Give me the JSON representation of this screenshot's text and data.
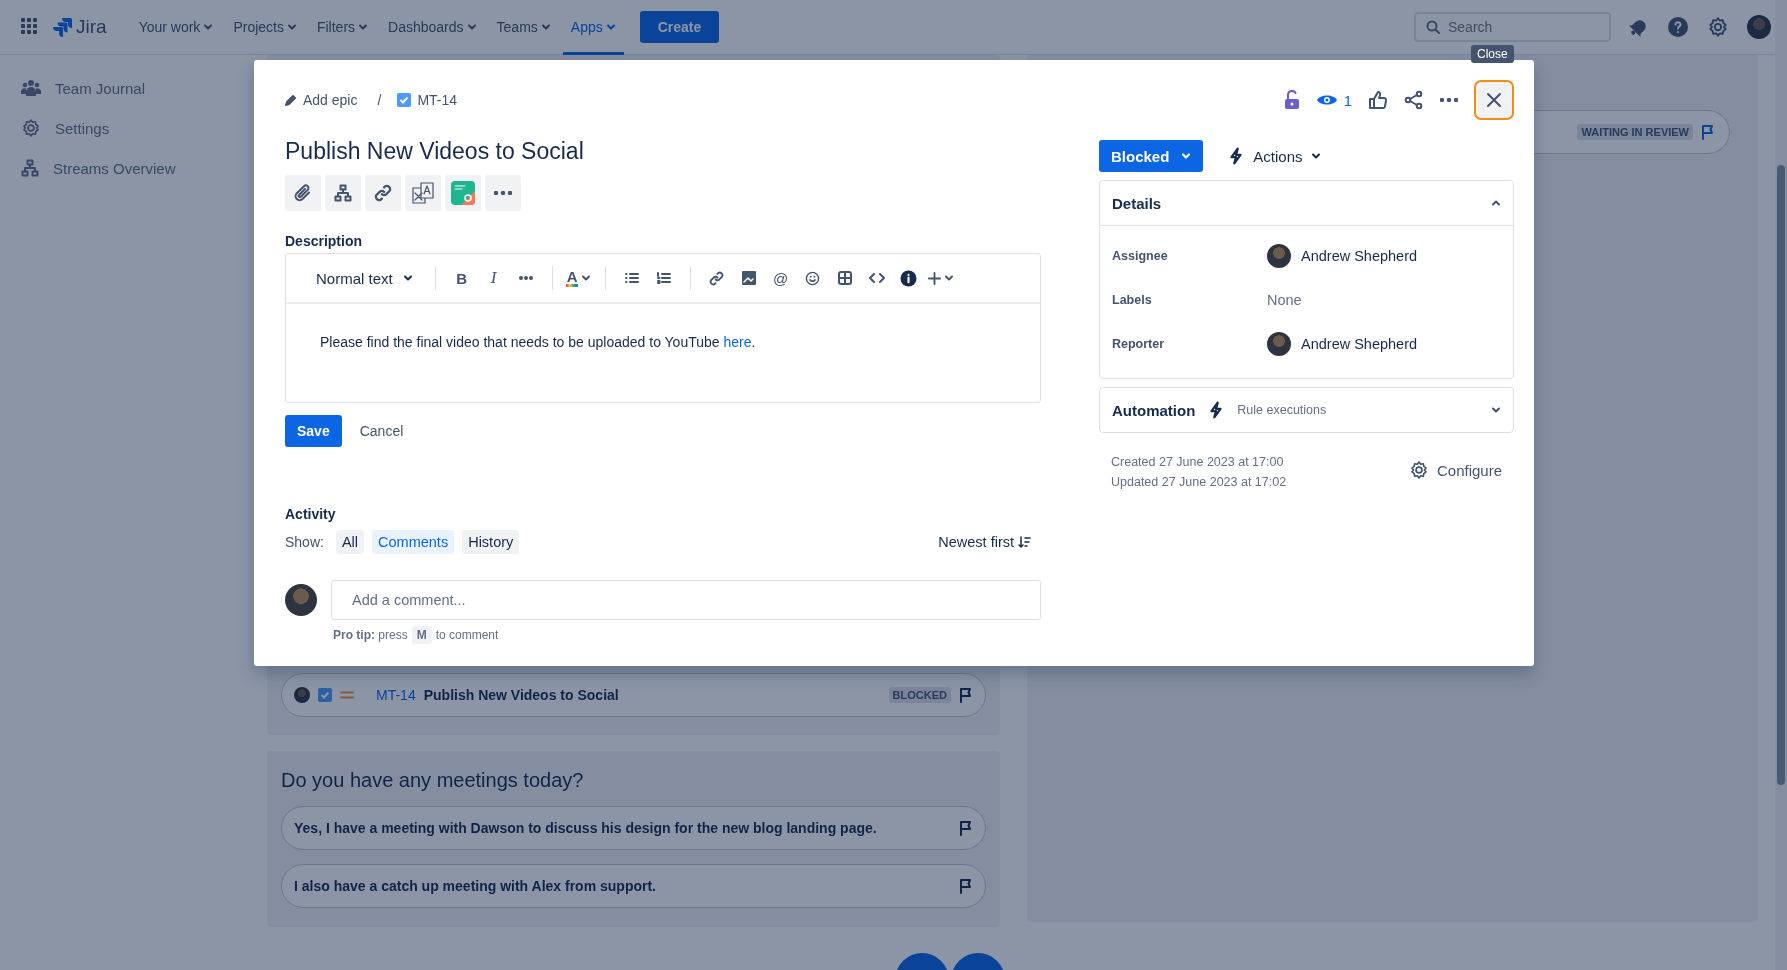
{
  "nav": {
    "logo": "Jira",
    "items": [
      {
        "label": "Your work",
        "selected": false
      },
      {
        "label": "Projects",
        "selected": false
      },
      {
        "label": "Filters",
        "selected": false
      },
      {
        "label": "Dashboards",
        "selected": false
      },
      {
        "label": "Teams",
        "selected": false
      },
      {
        "label": "Apps",
        "selected": true
      }
    ],
    "create": "Create",
    "search": {
      "placeholder": "Search"
    }
  },
  "sidebar": {
    "items": [
      {
        "label": "Team Journal",
        "kind": "team"
      },
      {
        "label": "Settings",
        "kind": "settings"
      },
      {
        "label": "Streams Overview",
        "kind": "hierarchy"
      }
    ]
  },
  "board": {
    "issue": {
      "key": "MT-14",
      "title": "Publish New Videos to Social",
      "status": "BLOCKED"
    },
    "meetings": {
      "question": "Do you have any meetings today?",
      "answers": [
        "Yes, I have a meeting with Dawson to discuss his design for the new blog landing page.",
        "I also have a catch up meeting with Alex from support."
      ]
    },
    "review": {
      "status": "WAITING IN REVIEW"
    }
  },
  "modal": {
    "breadcrumb": {
      "epic": "Add epic",
      "separator": "/",
      "key": "MT-14"
    },
    "watchers": "1",
    "close": {
      "tooltip": "Close",
      "focused": true
    },
    "title": "Publish New Videos to Social",
    "quick_actions": [
      {
        "kind": "attach"
      },
      {
        "kind": "child"
      },
      {
        "kind": "link"
      },
      {
        "kind": "translate"
      },
      {
        "kind": "app"
      },
      {
        "kind": "more"
      }
    ],
    "description": {
      "label": "Description",
      "toolbar": [
        {
          "kind": "text_style",
          "label": "Normal text"
        },
        {
          "kind": "divider"
        },
        {
          "kind": "bold",
          "glyph": "B"
        },
        {
          "kind": "italic",
          "glyph": "I"
        },
        {
          "kind": "more"
        },
        {
          "kind": "divider"
        },
        {
          "kind": "color",
          "glyph": "A"
        },
        {
          "kind": "divider"
        },
        {
          "kind": "bullets"
        },
        {
          "kind": "numbers"
        },
        {
          "kind": "divider"
        },
        {
          "kind": "link"
        },
        {
          "kind": "image"
        },
        {
          "kind": "mention",
          "glyph": "@"
        },
        {
          "kind": "emoji"
        },
        {
          "kind": "table"
        },
        {
          "kind": "code"
        },
        {
          "kind": "info"
        },
        {
          "kind": "insert"
        }
      ],
      "text": "Please find the final video that needs to be uploaded to YouTube",
      "link": "here",
      "after": "."
    },
    "save": "Save",
    "cancel": "Cancel",
    "activity": {
      "label": "Activity",
      "show_label": "Show:",
      "filters": [
        {
          "label": "All",
          "selected": false
        },
        {
          "label": "Comments",
          "selected": true
        },
        {
          "label": "History",
          "selected": false
        }
      ],
      "sort": "Newest first",
      "comment_placeholder": "Add a comment...",
      "pro_tip": "**Pro tip:** press",
      "key": "M",
      "pro_tip_after": "to comment"
    },
    "status": "Blocked",
    "actions": "Actions",
    "details": {
      "title": "Details",
      "expanded": true,
      "fields": [
        {
          "label": "Assignee",
          "kind": "person",
          "value": "Andrew Shepherd"
        },
        {
          "label": "Labels",
          "kind": "text",
          "value": "None"
        },
        {
          "label": "Reporter",
          "kind": "person",
          "value": "Andrew Shepherd"
        }
      ]
    },
    "automation": {
      "title": "Automation",
      "subtitle": "Rule executions",
      "expanded": false
    },
    "created": "Created 27 June 2023 at 17:00",
    "updated": "Updated 27 June 2023 at 17:02",
    "configure": "Configure"
  }
}
